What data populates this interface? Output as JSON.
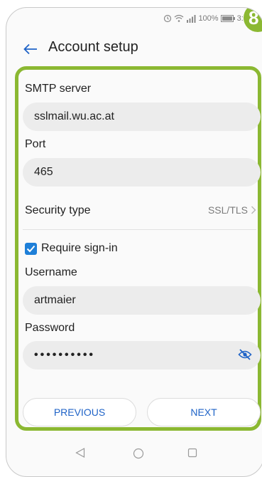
{
  "status_bar": {
    "battery": "100%",
    "time": "3:52",
    "step_badge": "8"
  },
  "header": {
    "title": "Account setup"
  },
  "form": {
    "smtp_server": {
      "label": "SMTP server",
      "value": "sslmail.wu.ac.at"
    },
    "port": {
      "label": "Port",
      "value": "465"
    },
    "security_type": {
      "label": "Security type",
      "value": "SSL/TLS"
    },
    "require_signin": {
      "label": "Require sign-in",
      "checked": true
    },
    "username": {
      "label": "Username",
      "value": "artmaier"
    },
    "password": {
      "label": "Password",
      "value": "••••••••••"
    }
  },
  "buttons": {
    "previous": "PREVIOUS",
    "next": "NEXT"
  },
  "colors": {
    "highlight_border": "#8bb832",
    "accent_blue": "#1f63c7",
    "checkbox_blue": "#1e7fd8",
    "field_bg": "#ececec"
  },
  "icons": {
    "back": "arrow-left-icon",
    "toggle_visibility": "eye-off-icon",
    "nav_back": "triangle-back-icon",
    "nav_home": "circle-home-icon",
    "nav_recents": "square-recents-icon"
  }
}
